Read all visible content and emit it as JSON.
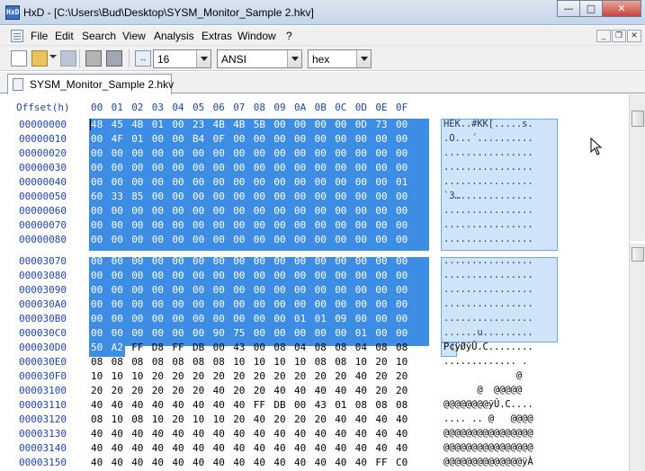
{
  "window": {
    "app_icon_text": "HxD",
    "title": "HxD - [C:\\Users\\Bud\\Desktop\\SYSM_Monitor_Sample 2.hkv]",
    "minimize_glyph": "—",
    "maximize_glyph": "□",
    "close_glyph": "✕"
  },
  "menu": {
    "items": [
      "File",
      "Edit",
      "Search",
      "View",
      "Analysis",
      "Extras",
      "Window",
      "?"
    ],
    "mdi_minimize": "_",
    "mdi_restore": "❐",
    "mdi_close": "✕"
  },
  "toolbar": {
    "bytes_per_row_icon": "↔",
    "bytes_per_row": "16",
    "charset": "ANSI",
    "offset_base": "hex"
  },
  "tab": {
    "label": "SYSM_Monitor_Sample 2.hkv"
  },
  "editor": {
    "offset_header": "Offset(h)",
    "column_headers": [
      "00",
      "01",
      "02",
      "03",
      "04",
      "05",
      "06",
      "07",
      "08",
      "09",
      "0A",
      "0B",
      "0C",
      "0D",
      "0E",
      "0F"
    ],
    "rows": [
      {
        "offset": "00000000",
        "bytes": [
          "48",
          "45",
          "4B",
          "01",
          "00",
          "23",
          "4B",
          "4B",
          "5B",
          "00",
          "00",
          "00",
          "00",
          "0D",
          "73",
          "00"
        ],
        "text": "HEK..#KK[.....s."
      },
      {
        "offset": "00000010",
        "bytes": [
          "00",
          "4F",
          "01",
          "00",
          "00",
          "B4",
          "0F",
          "00",
          "00",
          "00",
          "00",
          "00",
          "00",
          "00",
          "00",
          "00"
        ],
        "text": ".O...´.........."
      },
      {
        "offset": "00000020",
        "bytes": [
          "00",
          "00",
          "00",
          "00",
          "00",
          "00",
          "00",
          "00",
          "00",
          "00",
          "00",
          "00",
          "00",
          "00",
          "00",
          "00"
        ],
        "text": "................"
      },
      {
        "offset": "00000030",
        "bytes": [
          "00",
          "00",
          "00",
          "00",
          "00",
          "00",
          "00",
          "00",
          "00",
          "00",
          "00",
          "00",
          "00",
          "00",
          "00",
          "00"
        ],
        "text": "................"
      },
      {
        "offset": "00000040",
        "bytes": [
          "00",
          "00",
          "00",
          "00",
          "00",
          "00",
          "00",
          "00",
          "00",
          "00",
          "00",
          "00",
          "00",
          "00",
          "00",
          "01"
        ],
        "text": "................"
      },
      {
        "offset": "00000050",
        "bytes": [
          "60",
          "33",
          "85",
          "00",
          "00",
          "00",
          "00",
          "00",
          "00",
          "00",
          "00",
          "00",
          "00",
          "00",
          "00",
          "00"
        ],
        "text": "`3…............."
      },
      {
        "offset": "00000060",
        "bytes": [
          "00",
          "00",
          "00",
          "00",
          "00",
          "00",
          "00",
          "00",
          "00",
          "00",
          "00",
          "00",
          "00",
          "00",
          "00",
          "00"
        ],
        "text": "................"
      },
      {
        "offset": "00000070",
        "bytes": [
          "00",
          "00",
          "00",
          "00",
          "00",
          "00",
          "00",
          "00",
          "00",
          "00",
          "00",
          "00",
          "00",
          "00",
          "00",
          "00"
        ],
        "text": "................"
      },
      {
        "offset": "00000080",
        "bytes": [
          "00",
          "00",
          "00",
          "00",
          "00",
          "00",
          "00",
          "00",
          "00",
          "00",
          "00",
          "00",
          "00",
          "00",
          "00",
          "00"
        ],
        "text": "................"
      },
      {
        "offset": "00003070",
        "bytes": [
          "00",
          "00",
          "00",
          "00",
          "00",
          "00",
          "00",
          "00",
          "00",
          "00",
          "00",
          "00",
          "00",
          "00",
          "00",
          "00"
        ],
        "text": "................"
      },
      {
        "offset": "00003080",
        "bytes": [
          "00",
          "00",
          "00",
          "00",
          "00",
          "00",
          "00",
          "00",
          "00",
          "00",
          "00",
          "00",
          "00",
          "00",
          "00",
          "00"
        ],
        "text": "................"
      },
      {
        "offset": "00003090",
        "bytes": [
          "00",
          "00",
          "00",
          "00",
          "00",
          "00",
          "00",
          "00",
          "00",
          "00",
          "00",
          "00",
          "00",
          "00",
          "00",
          "00"
        ],
        "text": "................"
      },
      {
        "offset": "000030A0",
        "bytes": [
          "00",
          "00",
          "00",
          "00",
          "00",
          "00",
          "00",
          "00",
          "00",
          "00",
          "00",
          "00",
          "00",
          "00",
          "00",
          "00"
        ],
        "text": "................"
      },
      {
        "offset": "000030B0",
        "bytes": [
          "00",
          "00",
          "00",
          "00",
          "00",
          "00",
          "00",
          "00",
          "00",
          "00",
          "01",
          "01",
          "09",
          "00",
          "00",
          "00"
        ],
        "text": "................"
      },
      {
        "offset": "000030C0",
        "bytes": [
          "00",
          "00",
          "00",
          "00",
          "00",
          "00",
          "90",
          "75",
          "00",
          "00",
          "00",
          "00",
          "00",
          "01",
          "00",
          "00"
        ],
        "text": "......u........."
      },
      {
        "offset": "000030D0",
        "bytes": [
          "50",
          "A2",
          "FF",
          "D8",
          "FF",
          "DB",
          "00",
          "43",
          "00",
          "08",
          "04",
          "08",
          "08",
          "04",
          "08",
          "08"
        ],
        "text": "P¢ÿØÿÛ.C........"
      },
      {
        "offset": "000030E0",
        "bytes": [
          "08",
          "08",
          "08",
          "08",
          "08",
          "08",
          "08",
          "10",
          "10",
          "10",
          "10",
          "08",
          "08",
          "10",
          "20",
          "10"
        ],
        "text": "............. ."
      },
      {
        "offset": "000030F0",
        "bytes": [
          "10",
          "10",
          "10",
          "20",
          "20",
          "20",
          "20",
          "20",
          "20",
          "20",
          "20",
          "20",
          "20",
          "40",
          "20",
          "20"
        ],
        "text": "             @  "
      },
      {
        "offset": "00003100",
        "bytes": [
          "20",
          "20",
          "20",
          "20",
          "20",
          "20",
          "40",
          "20",
          "20",
          "40",
          "40",
          "40",
          "40",
          "40",
          "20",
          "20"
        ],
        "text": "      @  @@@@@  "
      },
      {
        "offset": "00003110",
        "bytes": [
          "40",
          "40",
          "40",
          "40",
          "40",
          "40",
          "40",
          "40",
          "FF",
          "DB",
          "00",
          "43",
          "01",
          "08",
          "08",
          "08"
        ],
        "text": "@@@@@@@@ÿÛ.C...."
      },
      {
        "offset": "00003120",
        "bytes": [
          "08",
          "10",
          "08",
          "10",
          "20",
          "10",
          "10",
          "20",
          "40",
          "20",
          "20",
          "20",
          "40",
          "40",
          "40",
          "40"
        ],
        "text": ".... .. @   @@@@"
      },
      {
        "offset": "00003130",
        "bytes": [
          "40",
          "40",
          "40",
          "40",
          "40",
          "40",
          "40",
          "40",
          "40",
          "40",
          "40",
          "40",
          "40",
          "40",
          "40",
          "40"
        ],
        "text": "@@@@@@@@@@@@@@@@"
      },
      {
        "offset": "00003140",
        "bytes": [
          "40",
          "40",
          "40",
          "40",
          "40",
          "40",
          "40",
          "40",
          "40",
          "40",
          "40",
          "40",
          "40",
          "40",
          "40",
          "40"
        ],
        "text": "@@@@@@@@@@@@@@@@"
      },
      {
        "offset": "00003150",
        "bytes": [
          "40",
          "40",
          "40",
          "40",
          "40",
          "40",
          "40",
          "40",
          "40",
          "40",
          "40",
          "40",
          "40",
          "40",
          "FF",
          "C0"
        ],
        "text": "@@@@@@@@@@@@@@ÿÀ"
      }
    ]
  }
}
